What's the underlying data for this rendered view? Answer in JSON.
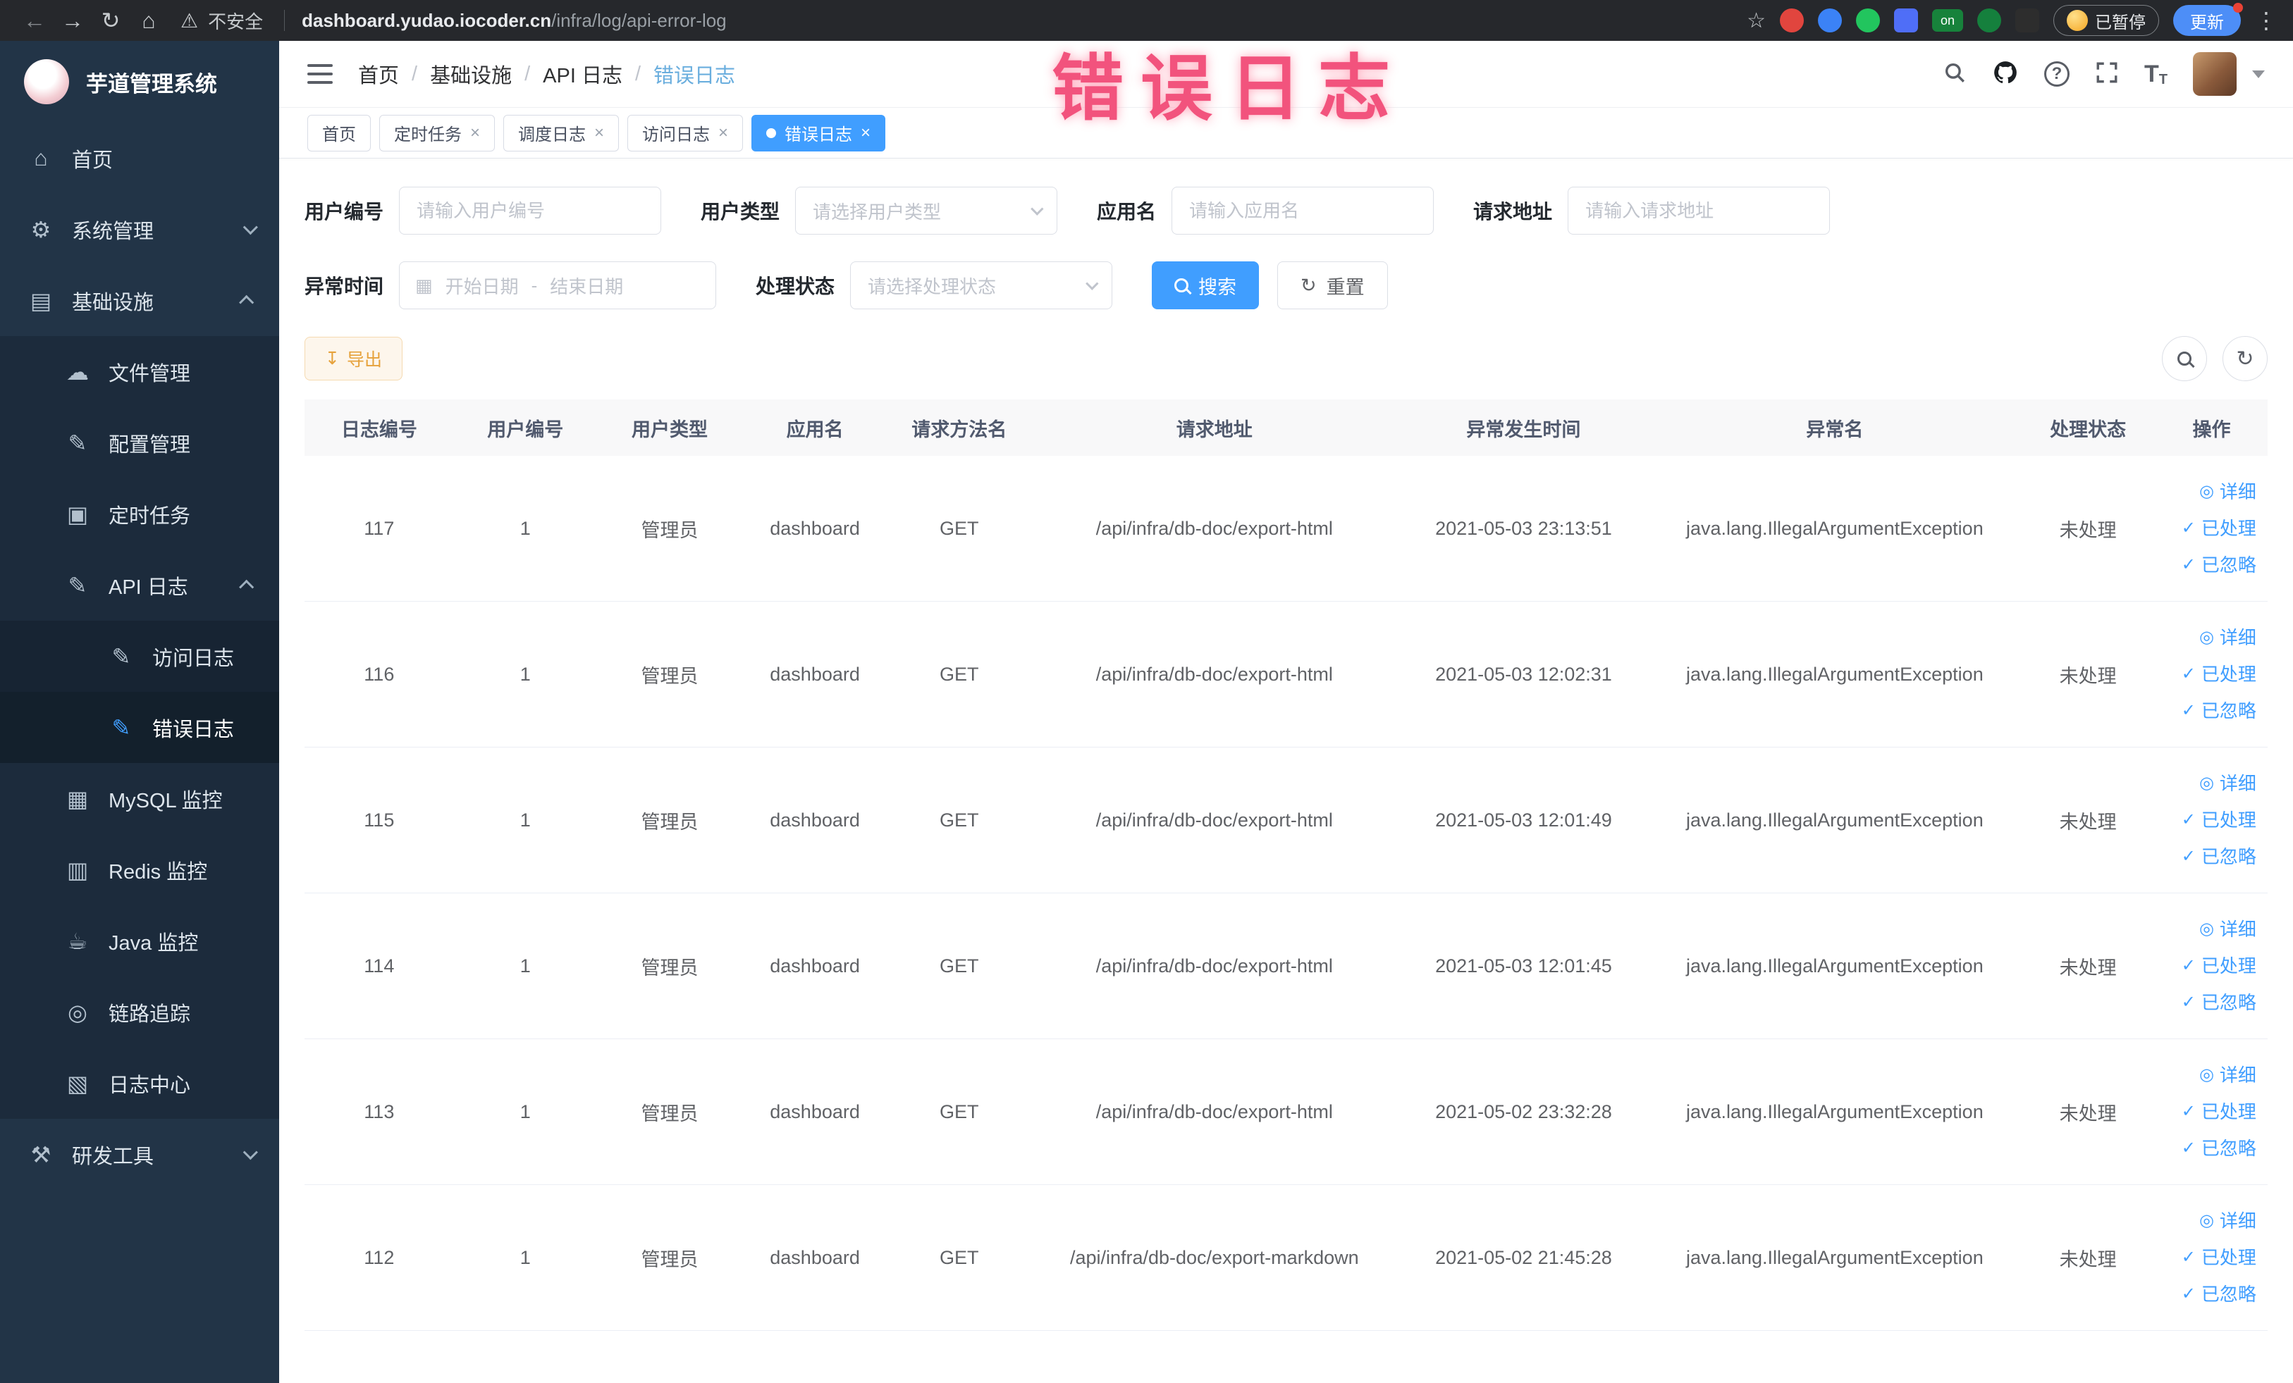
{
  "colors": {
    "accent": "#409eff",
    "overlay": "#f2537d",
    "warning": "#e6a23c",
    "sidebar_bg": "#223447"
  },
  "browser": {
    "security_label": "不安全",
    "url_host": "dashboard.yudao.iocoder.cn",
    "url_path": "/infra/log/api-error-log",
    "ext_on_label": "on",
    "paused_label": "已暂停",
    "update_label": "更新"
  },
  "overlay": {
    "title": "错误日志",
    "color": "#f2537d"
  },
  "sidebar": {
    "logo_title": "芋道管理系统",
    "items": [
      {
        "label": "首页"
      },
      {
        "label": "系统管理"
      },
      {
        "label": "基础设施"
      },
      {
        "label": "文件管理"
      },
      {
        "label": "配置管理"
      },
      {
        "label": "定时任务"
      },
      {
        "label": "API 日志"
      },
      {
        "label": "访问日志"
      },
      {
        "label": "错误日志"
      },
      {
        "label": "MySQL 监控"
      },
      {
        "label": "Redis 监控"
      },
      {
        "label": "Java 监控"
      },
      {
        "label": "链路追踪"
      },
      {
        "label": "日志中心"
      },
      {
        "label": "研发工具"
      }
    ]
  },
  "header": {
    "breadcrumbs": [
      "首页",
      "基础设施",
      "API 日志",
      "错误日志"
    ]
  },
  "tabs": [
    {
      "label": "首页",
      "closable": false,
      "active": false
    },
    {
      "label": "定时任务",
      "closable": true,
      "active": false
    },
    {
      "label": "调度日志",
      "closable": true,
      "active": false
    },
    {
      "label": "访问日志",
      "closable": true,
      "active": false
    },
    {
      "label": "错误日志",
      "closable": true,
      "active": true
    }
  ],
  "filters": {
    "user_id": {
      "label": "用户编号",
      "placeholder": "请输入用户编号",
      "value": ""
    },
    "user_type": {
      "label": "用户类型",
      "placeholder": "请选择用户类型",
      "value": ""
    },
    "app_name": {
      "label": "应用名",
      "placeholder": "请输入应用名",
      "value": ""
    },
    "request_url": {
      "label": "请求地址",
      "placeholder": "请输入请求地址",
      "value": ""
    },
    "exception_time": {
      "label": "异常时间",
      "start_placeholder": "开始日期",
      "separator": "-",
      "end_placeholder": "结束日期"
    },
    "process_status": {
      "label": "处理状态",
      "placeholder": "请选择处理状态",
      "value": ""
    },
    "search_label": "搜索",
    "reset_label": "重置"
  },
  "toolbar": {
    "export_label": "导出"
  },
  "table": {
    "columns": [
      "日志编号",
      "用户编号",
      "用户类型",
      "应用名",
      "请求方法名",
      "请求地址",
      "异常发生时间",
      "异常名",
      "处理状态",
      "操作"
    ],
    "action_labels": {
      "detail": "详细",
      "processed": "已处理",
      "ignored": "已忽略"
    },
    "rows": [
      {
        "id": "117",
        "user_id": "1",
        "user_type": "管理员",
        "app": "dashboard",
        "method": "GET",
        "url": "/api/infra/db-doc/export-html",
        "time": "2021-05-03 23:13:51",
        "exception": "java.lang.IllegalArgumentException",
        "status": "未处理"
      },
      {
        "id": "116",
        "user_id": "1",
        "user_type": "管理员",
        "app": "dashboard",
        "method": "GET",
        "url": "/api/infra/db-doc/export-html",
        "time": "2021-05-03 12:02:31",
        "exception": "java.lang.IllegalArgumentException",
        "status": "未处理"
      },
      {
        "id": "115",
        "user_id": "1",
        "user_type": "管理员",
        "app": "dashboard",
        "method": "GET",
        "url": "/api/infra/db-doc/export-html",
        "time": "2021-05-03 12:01:49",
        "exception": "java.lang.IllegalArgumentException",
        "status": "未处理"
      },
      {
        "id": "114",
        "user_id": "1",
        "user_type": "管理员",
        "app": "dashboard",
        "method": "GET",
        "url": "/api/infra/db-doc/export-html",
        "time": "2021-05-03 12:01:45",
        "exception": "java.lang.IllegalArgumentException",
        "status": "未处理"
      },
      {
        "id": "113",
        "user_id": "1",
        "user_type": "管理员",
        "app": "dashboard",
        "method": "GET",
        "url": "/api/infra/db-doc/export-html",
        "time": "2021-05-02 23:32:28",
        "exception": "java.lang.IllegalArgumentException",
        "status": "未处理"
      },
      {
        "id": "112",
        "user_id": "1",
        "user_type": "管理员",
        "app": "dashboard",
        "method": "GET",
        "url": "/api/infra/db-doc/export-markdown",
        "time": "2021-05-02 21:45:28",
        "exception": "java.lang.IllegalArgumentException",
        "status": "未处理"
      }
    ]
  }
}
